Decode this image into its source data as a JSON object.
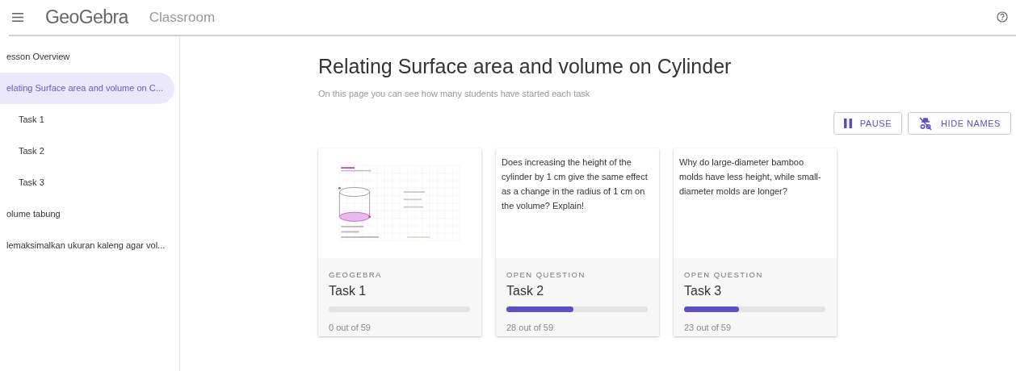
{
  "header": {
    "brand": "GeoGebra",
    "product": "Classroom"
  },
  "sidebar": {
    "items": [
      {
        "label": "esson Overview",
        "selected": false
      },
      {
        "label": "elating Surface area and volume on C...",
        "selected": true,
        "children": [
          {
            "label": "Task 1",
            "selected": false
          },
          {
            "label": "Task 2",
            "selected": false
          },
          {
            "label": "Task 3",
            "selected": false
          }
        ]
      },
      {
        "label": "olume tabung",
        "selected": false
      },
      {
        "label": "lemaksimalkan ukuran kaleng agar vol...",
        "selected": false
      }
    ]
  },
  "page": {
    "title": "Relating Surface area and volume on Cylinder",
    "subtitle": "On this page you can see how many students have started each task"
  },
  "actions": [
    {
      "kind": "pause",
      "label": "PAUSE"
    },
    {
      "kind": "hide-names",
      "label": "HIDE NAMES"
    }
  ],
  "tasks": [
    {
      "kind": "applet",
      "type": "GEOGEBRA",
      "title": "Task 1",
      "level": 0,
      "count": "0 out of 59"
    },
    {
      "kind": "question",
      "question": "Does increasing the height of the cylinder by 1 cm give the same effect as a change in the radius of 1 cm on the volume? Explain!",
      "type": "OPEN QUESTION",
      "title": "Task 2",
      "level": 0.475,
      "count": "28 out of 59"
    },
    {
      "kind": "question",
      "question": "Why do large-diameter bamboo molds have less height, while small-diameter molds are longer?",
      "type": "OPEN QUESTION",
      "title": "Task 3",
      "level": 0.39,
      "count": "23 out of 59"
    }
  ]
}
